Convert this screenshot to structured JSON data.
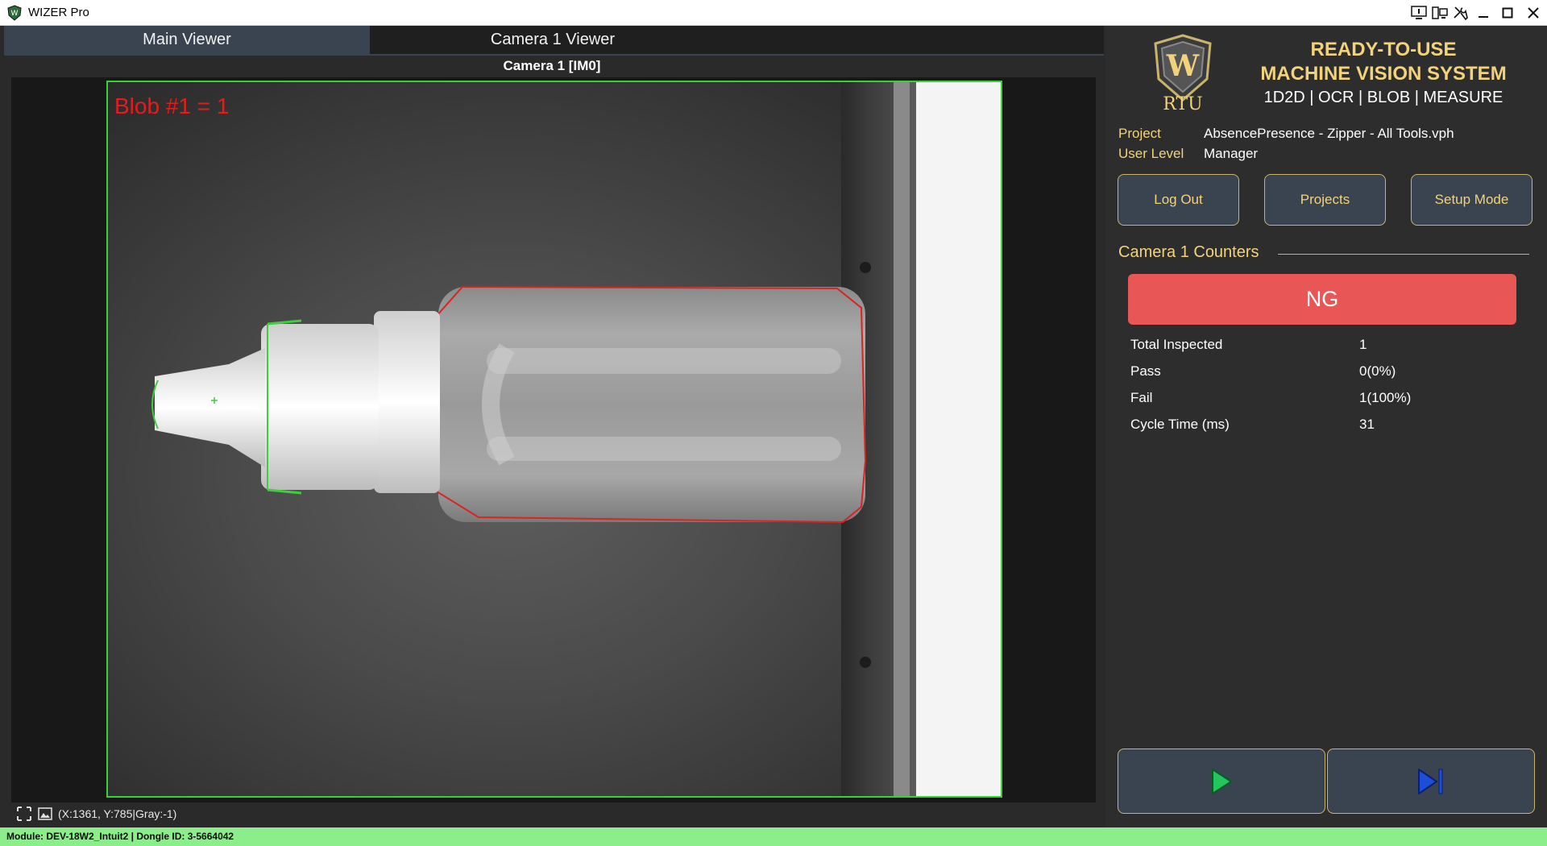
{
  "window": {
    "title": "WIZER Pro"
  },
  "tabs": [
    {
      "label": "Main Viewer",
      "active": true
    },
    {
      "label": "Camera 1 Viewer",
      "active": false
    }
  ],
  "viewer": {
    "camera_label": "Camera 1  [IM0]",
    "overlay_text": "Blob #1 = 1",
    "overlay_color": "#e11d1d",
    "roi_color": "#35d23a",
    "coords": "(X:1361, Y:785|Gray:-1)"
  },
  "status_bar": {
    "text": "Module: DEV-18W2_Intuit2 | Dongle ID: 3-5664042",
    "color": "#8bee8b"
  },
  "brand": {
    "logo_text": "RTU",
    "logo_letter": "W",
    "line1": "READY-TO-USE",
    "line2": "MACHINE VISION SYSTEM",
    "subtitle": "1D2D | OCR | BLOB | MEASURE",
    "accent": "#f2d37c"
  },
  "project": {
    "project_label": "Project",
    "project_value": "AbsencePresence - Zipper - All Tools.vph",
    "user_label": "User Level",
    "user_value": "Manager"
  },
  "buttons": {
    "logout": "Log Out",
    "projects": "Projects",
    "setup": "Setup Mode"
  },
  "counters": {
    "title": "Camera 1 Counters",
    "result": "NG",
    "result_color": "#e95656",
    "rows": [
      {
        "label": "Total Inspected",
        "value": "1"
      },
      {
        "label": "Pass",
        "value": "0(0%)"
      },
      {
        "label": "Fail",
        "value": "1(100%)"
      },
      {
        "label": "Cycle Time (ms)",
        "value": "31"
      }
    ]
  },
  "controls": {
    "run_icon": "play-icon",
    "run_color": "#22c55e",
    "step_icon": "step-forward-icon",
    "step_color": "#1d4ed8"
  }
}
